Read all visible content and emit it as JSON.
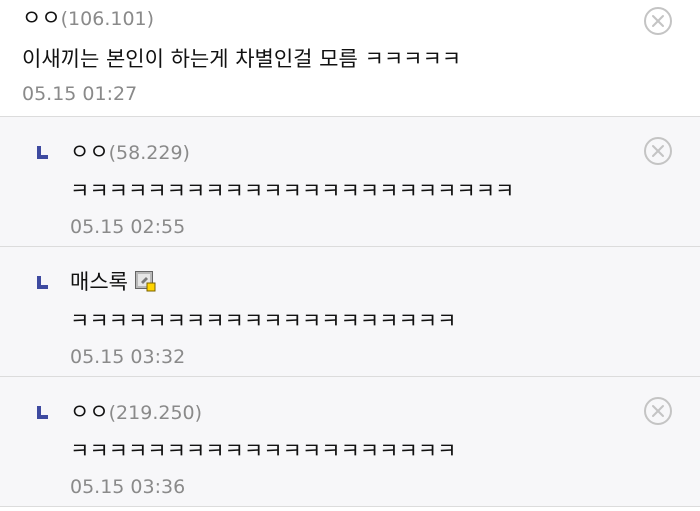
{
  "comments": [
    {
      "nickname": "ㅇㅇ",
      "ip": "(106.101)",
      "text": "이새끼는 본인이 하는게 차별인걸 모름 ㅋㅋㅋㅋㅋ",
      "date": "05.15 01:27",
      "deletable": true
    },
    {
      "nickname": "ㅇㅇ",
      "ip": "(58.229)",
      "text": "ㅋㅋㅋㅋㅋㅋㅋㅋㅋㅋㅋㅋㅋㅋㅋㅋㅋㅋㅋㅋㅋㅋㅋ",
      "date": "05.15 02:55",
      "deletable": true
    },
    {
      "nickname": "매스록",
      "ip": "",
      "member_icon": "fixed-nick-member-icon",
      "text": "ㅋㅋㅋㅋㅋㅋㅋㅋㅋㅋㅋㅋㅋㅋㅋㅋㅋㅋㅋㅋ",
      "date": "05.15 03:32",
      "deletable": false
    },
    {
      "nickname": "ㅇㅇ",
      "ip": "(219.250)",
      "text": "ㅋㅋㅋㅋㅋㅋㅋㅋㅋㅋㅋㅋㅋㅋㅋㅋㅋㅋㅋㅋ",
      "date": "05.15 03:36",
      "deletable": true
    }
  ],
  "icons": {
    "delete": "circle-x-icon",
    "reply": "reply-arrow-icon"
  },
  "colors": {
    "reply_arrow": "#3e4aa0",
    "meta_text": "#8a8a8a",
    "reply_background": "#f7f7f9",
    "divider": "#dcdcdc"
  }
}
